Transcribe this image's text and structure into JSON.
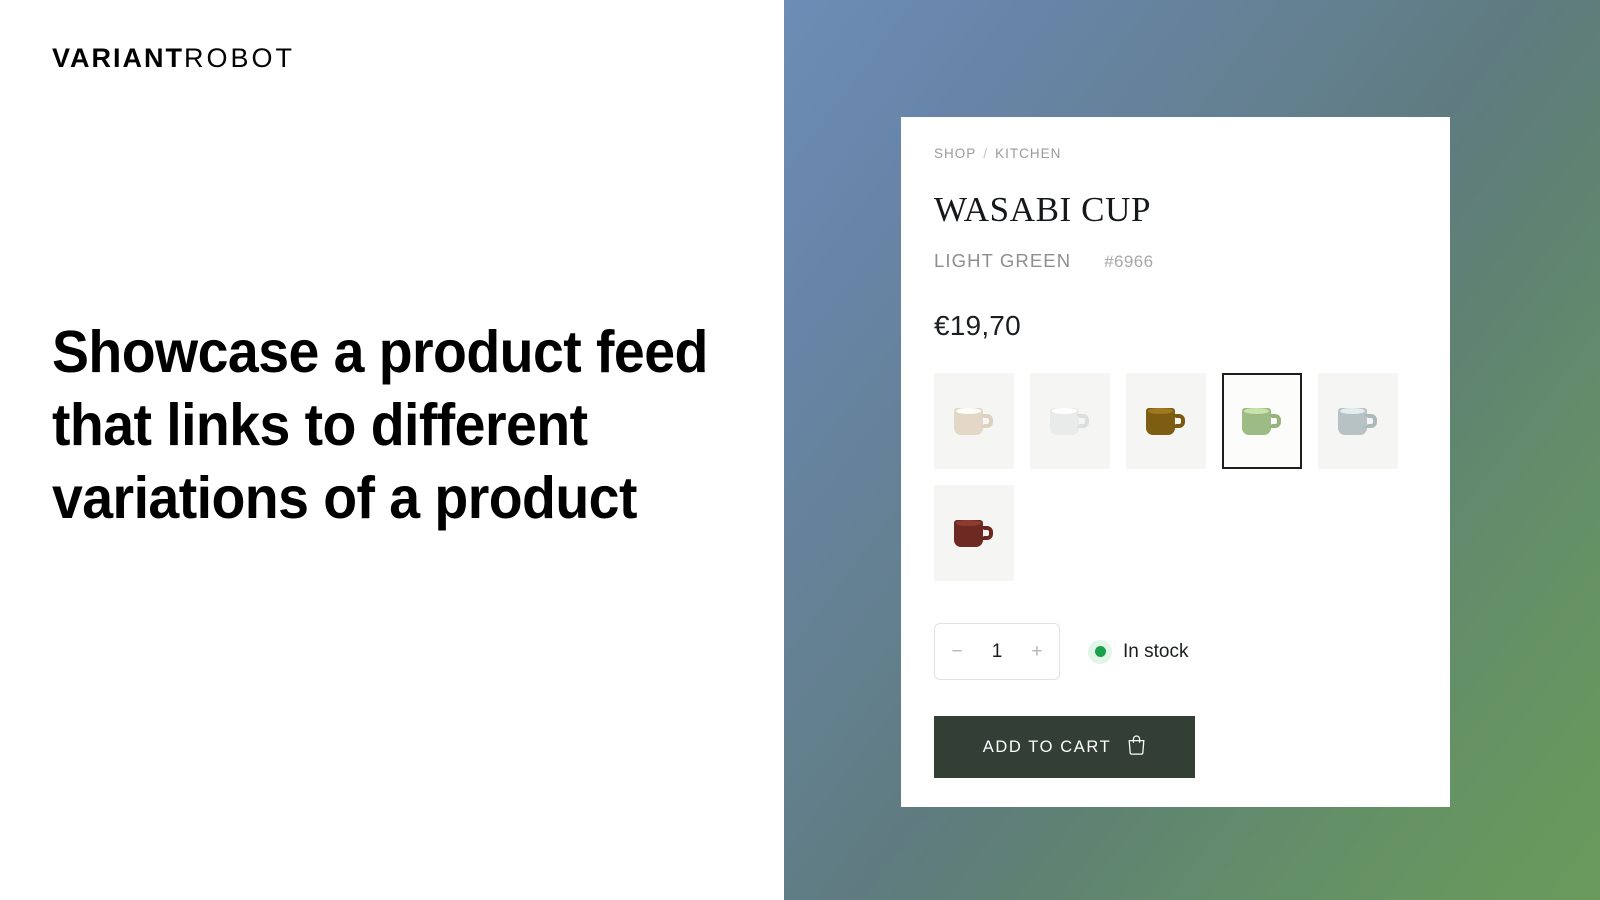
{
  "brand": {
    "strong": "VARIANT",
    "light": "ROBOT"
  },
  "headline": "Showcase a product feed that links to different variations of a product",
  "theme": {
    "gradient_start": "#6d8db6",
    "gradient_mid": "#5f7b80",
    "gradient_end": "#699a5c",
    "card_background": "#ffffff",
    "accent_button": "#333f35",
    "stock_green": "#18a04a"
  },
  "product_card": {
    "breadcrumb": {
      "items": [
        "SHOP",
        "KITCHEN"
      ],
      "separator": "/"
    },
    "title": "WASABI CUP",
    "variant_name": "LIGHT GREEN",
    "sku": "#6966",
    "price": "€19,70",
    "swatches": [
      {
        "name": "beige",
        "body": "#e3d7c8",
        "rim": "#f0e8dc",
        "handle": "#ddd0bf",
        "selected": false
      },
      {
        "name": "white",
        "body": "#e9eaea",
        "rim": "#f6f6f6",
        "handle": "#dcdedd",
        "selected": false
      },
      {
        "name": "brown",
        "body": "#7d5d12",
        "rim": "#8d6b1a",
        "handle": "#7a5a10",
        "selected": false
      },
      {
        "name": "light-green",
        "body": "#9dbb84",
        "rim": "#b1c998",
        "handle": "#95b37c",
        "selected": true
      },
      {
        "name": "blue-grey",
        "body": "#b6c2c4",
        "rim": "#c9d2d3",
        "handle": "#acb9bb",
        "selected": false
      },
      {
        "name": "dark-red",
        "body": "#6e2a22",
        "rim": "#7d352b",
        "handle": "#6a2720",
        "selected": false
      }
    ],
    "quantity": {
      "decrement_label": "−",
      "value": "1",
      "increment_label": "+"
    },
    "stock": {
      "label": "In stock"
    },
    "cart_button": {
      "label": "ADD TO CART",
      "icon": "shopping-bag-icon"
    }
  }
}
